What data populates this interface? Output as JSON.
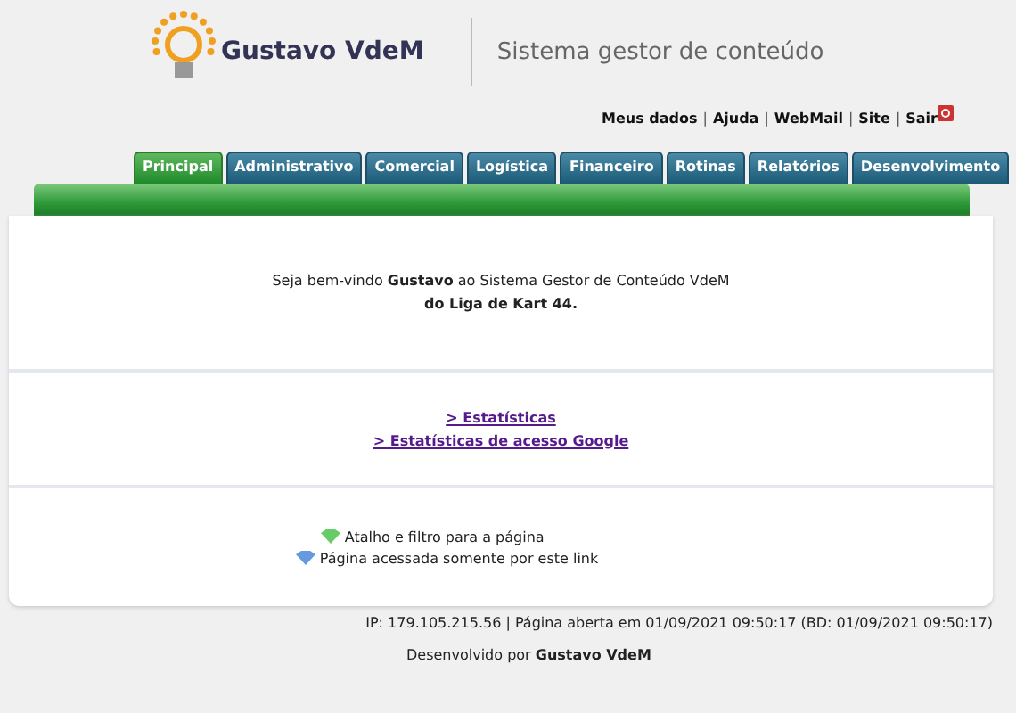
{
  "header": {
    "brand": "Gustavo VdeM",
    "subtitle": "Sistema gestor de conteúdo"
  },
  "top_links": {
    "separator": "|",
    "items": [
      {
        "label": "Meus dados"
      },
      {
        "label": "Ajuda"
      },
      {
        "label": "WebMail"
      },
      {
        "label": "Site"
      },
      {
        "label": "Sair",
        "kind": "exit"
      }
    ]
  },
  "tabs": [
    {
      "label": "Principal",
      "selected": true
    },
    {
      "label": "Administrativo",
      "selected": false
    },
    {
      "label": "Comercial",
      "selected": false
    },
    {
      "label": "Logística",
      "selected": false
    },
    {
      "label": "Financeiro",
      "selected": false
    },
    {
      "label": "Rotinas",
      "selected": false
    },
    {
      "label": "Relatórios",
      "selected": false
    },
    {
      "label": "Desenvolvimento",
      "selected": false
    }
  ],
  "welcome": {
    "line_1": "Seja bem-vindo **Gustavo** ao Sistema Gestor de Conteúdo VdeM",
    "line_2": "do Liga de Kart 44."
  },
  "links": [
    "> Estatísticas",
    "> Estatísticas de acesso Google"
  ],
  "legend": [
    {
      "label": "Atalho e filtro para a página",
      "color": "#66cc66"
    },
    {
      "label": "Página acessada somente por este link",
      "color": "#6699dd"
    }
  ],
  "footer": {
    "info": "IP: 179.105.215.56 | Página aberta em 01/09/2021 09:50:17 (BD: 01/09/2021 09:50:17)",
    "credit": "Desenvolvido por **Gustavo VdeM**"
  }
}
